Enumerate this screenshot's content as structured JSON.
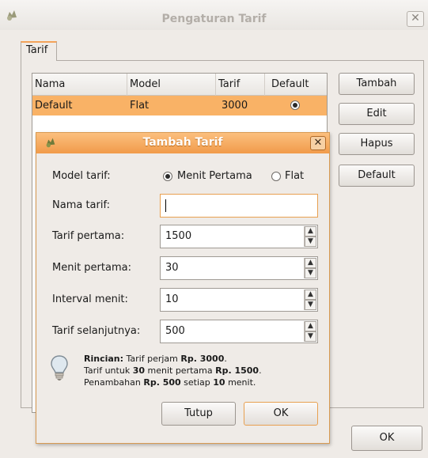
{
  "window": {
    "title": "Pengaturan Tarif",
    "close_glyph": "✕",
    "icon": "app-icon"
  },
  "tabs": [
    {
      "label": "Tarif",
      "active": true
    }
  ],
  "table": {
    "columns": [
      "Nama",
      "Model",
      "Tarif",
      "Default"
    ],
    "rows": [
      {
        "nama": "Default",
        "model": "Flat",
        "tarif": "3000",
        "default": true
      }
    ]
  },
  "side_buttons": {
    "tambah": "Tambah",
    "edit": "Edit",
    "hapus": "Hapus",
    "default": "Default"
  },
  "footer": {
    "ok": "OK"
  },
  "dialog": {
    "title": "Tambah Tarif",
    "close_glyph": "✕",
    "model_label": "Model tarif:",
    "model_options": [
      {
        "label": "Menit Pertama",
        "selected": true
      },
      {
        "label": "Flat",
        "selected": false
      }
    ],
    "fields": {
      "nama_label": "Nama tarif:",
      "nama_value": "",
      "tarif_pertama_label": "Tarif pertama:",
      "tarif_pertama_value": "1500",
      "menit_pertama_label": "Menit pertama:",
      "menit_pertama_value": "30",
      "interval_label": "Interval menit:",
      "interval_value": "10",
      "tarif_selanjutnya_label": "Tarif selanjutnya:",
      "tarif_selanjutnya_value": "500"
    },
    "info": {
      "line1_bold": "Rincian:",
      "line1_text": " Tarif perjam ",
      "line1_amount": "Rp. 3000",
      "line1_end": ".",
      "line2_a": "Tarif untuk ",
      "line2_b": "30",
      "line2_c": " menit pertama ",
      "line2_d": "Rp. 1500",
      "line2_e": ".",
      "line3_a": "Penambahan ",
      "line3_b": "Rp. 500",
      "line3_c": " setiap ",
      "line3_d": "10",
      "line3_e": " menit."
    },
    "buttons": {
      "tutup": "Tutup",
      "ok": "OK"
    }
  },
  "colors": {
    "accent": "#f19b4a",
    "selection": "#f9b266",
    "window_bg": "#efebe7"
  }
}
